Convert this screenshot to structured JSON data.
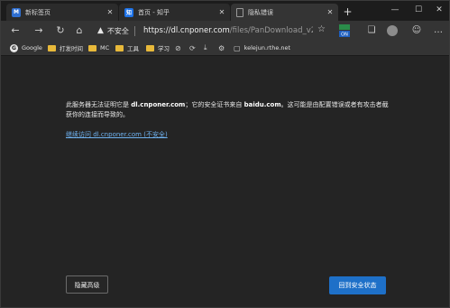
{
  "tabs": [
    {
      "label": "新标签页",
      "favicon_text": "M",
      "favicon_color": "#2f6fd1",
      "active": false
    },
    {
      "label": "首页 - 知乎",
      "favicon_text": "知",
      "favicon_color": "#1e73e8",
      "active": false
    },
    {
      "label": "隐私错误",
      "favicon_text": "",
      "favicon_color": "#3a3a3a",
      "active": true
    }
  ],
  "new_tab_label": "+",
  "window_controls": {
    "minimize": "—",
    "maximize": "☐",
    "close": "✕"
  },
  "address_bar": {
    "security_label": "不安全",
    "url_scheme_host": "https://dl.cnponer.com",
    "url_path": "/files/PanDownload_v2.2.2...",
    "extension_badge": "ON"
  },
  "bookmarks": [
    {
      "label": "Google",
      "type": "google"
    },
    {
      "label": "打发时间",
      "type": "folder"
    },
    {
      "label": "MC",
      "type": "folder"
    },
    {
      "label": "工具",
      "type": "folder"
    },
    {
      "label": "学习",
      "type": "folder"
    },
    {
      "label": "kelejun.rthe.net",
      "type": "page"
    }
  ],
  "error": {
    "message_prefix": "此服务器无法证明它是 ",
    "domain_bold": "dl.cnponer.com",
    "message_mid": "；它的安全证书来自 ",
    "issuer_bold": "baidu.com",
    "message_suffix": "。这可能是由配置错误或者有攻击者截获你的连接而导致的。",
    "proceed_link": "继续访问 dl.cnponer.com (不安全)",
    "advanced_button": "隐藏高级",
    "back_button": "回到安全状态"
  }
}
